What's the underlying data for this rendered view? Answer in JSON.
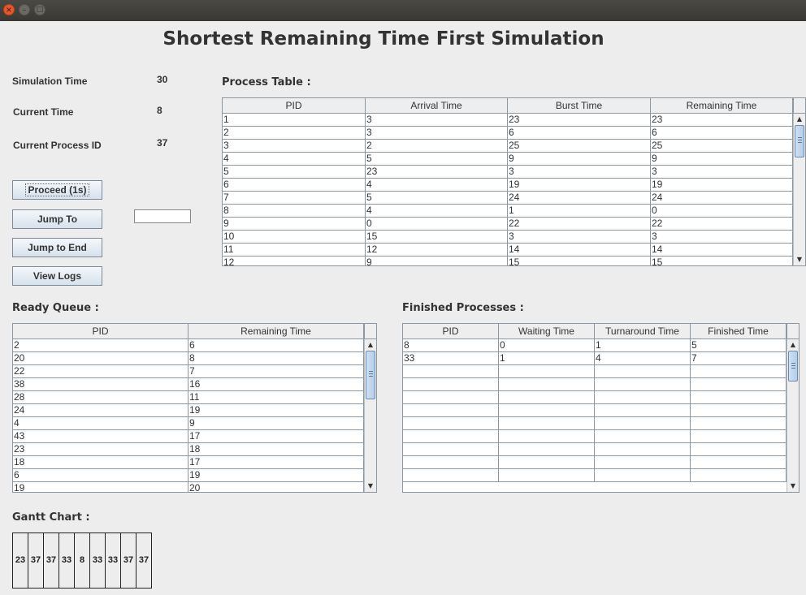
{
  "window": {
    "close_glyph": "×",
    "min_glyph": "–",
    "max_glyph": "□"
  },
  "title": "Shortest Remaining Time First Simulation",
  "info": {
    "simulation_time_label": "Simulation Time",
    "simulation_time_value": "30",
    "current_time_label": "Current Time",
    "current_time_value": "8",
    "current_process_label": "Current Process ID",
    "current_process_value": "37"
  },
  "buttons": {
    "proceed": "Proceed (1s)",
    "jump_to": "Jump To",
    "jump_to_end": "Jump to End",
    "view_logs": "View Logs"
  },
  "jump_input": {
    "value": ""
  },
  "process_table": {
    "label": "Process Table :",
    "columns": [
      "PID",
      "Arrival Time",
      "Burst Time",
      "Remaining Time"
    ],
    "rows": [
      [
        "1",
        "3",
        "23",
        "23"
      ],
      [
        "2",
        "3",
        "6",
        "6"
      ],
      [
        "3",
        "2",
        "25",
        "25"
      ],
      [
        "4",
        "5",
        "9",
        "9"
      ],
      [
        "5",
        "23",
        "3",
        "3"
      ],
      [
        "6",
        "4",
        "19",
        "19"
      ],
      [
        "7",
        "5",
        "24",
        "24"
      ],
      [
        "8",
        "4",
        "1",
        "0"
      ],
      [
        "9",
        "0",
        "22",
        "22"
      ],
      [
        "10",
        "15",
        "3",
        "3"
      ],
      [
        "11",
        "12",
        "14",
        "14"
      ],
      [
        "12",
        "9",
        "15",
        "15"
      ]
    ]
  },
  "ready_queue": {
    "label": "Ready Queue :",
    "columns": [
      "PID",
      "Remaining Time"
    ],
    "rows": [
      [
        "2",
        "6"
      ],
      [
        "20",
        "8"
      ],
      [
        "22",
        "7"
      ],
      [
        "38",
        "16"
      ],
      [
        "28",
        "11"
      ],
      [
        "24",
        "19"
      ],
      [
        "4",
        "9"
      ],
      [
        "43",
        "17"
      ],
      [
        "23",
        "18"
      ],
      [
        "18",
        "17"
      ],
      [
        "6",
        "19"
      ],
      [
        "19",
        "20"
      ]
    ]
  },
  "finished": {
    "label": "Finished Processes :",
    "columns": [
      "PID",
      "Waiting Time",
      "Turnaround Time",
      "Finished Time"
    ],
    "rows": [
      [
        "8",
        "0",
        "1",
        "5"
      ],
      [
        "33",
        "1",
        "4",
        "7"
      ],
      [
        "",
        "",
        "",
        ""
      ],
      [
        "",
        "",
        "",
        ""
      ],
      [
        "",
        "",
        "",
        ""
      ],
      [
        "",
        "",
        "",
        ""
      ],
      [
        "",
        "",
        "",
        ""
      ],
      [
        "",
        "",
        "",
        ""
      ],
      [
        "",
        "",
        "",
        ""
      ],
      [
        "",
        "",
        "",
        ""
      ],
      [
        "",
        "",
        "",
        ""
      ]
    ]
  },
  "gantt": {
    "label": "Gantt Chart :",
    "cells": [
      "23",
      "37",
      "37",
      "33",
      "8",
      "33",
      "33",
      "37",
      "37"
    ]
  },
  "scroll_icons": {
    "up": "▲",
    "down": "▼"
  }
}
